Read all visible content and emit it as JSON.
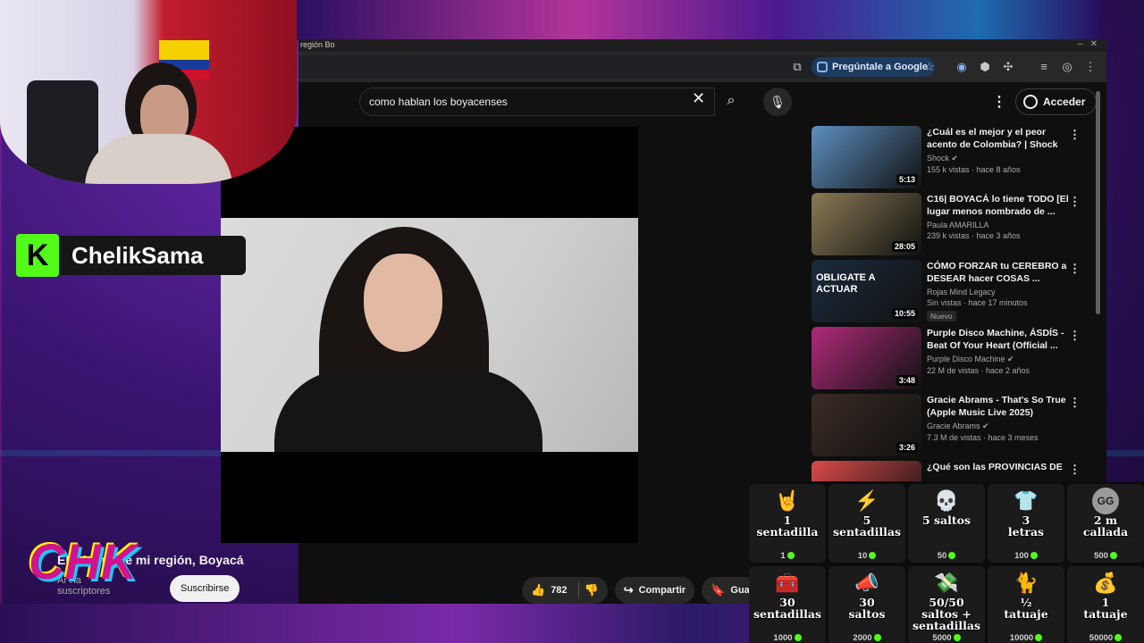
{
  "browser": {
    "tab_title": "región Bo",
    "ask_google_label": "Pregúntale a Google"
  },
  "youtube": {
    "search_query": "como hablan los boyacenses",
    "signin_label": "Acceder",
    "video": {
      "title": "El género de mi región, Boyacá",
      "channel_fragment": "Ar ría",
      "subscribers": "suscriptores",
      "subscribe_label": "Suscribirse",
      "likes": "782",
      "share_label": "Compartir",
      "save_label": "Guard"
    },
    "recommendations": [
      {
        "title": "¿Cuál es el mejor y el peor acento de Colombia? | Shock",
        "channel": "Shock",
        "verified": true,
        "views": "155 k vistas · hace 8 años",
        "duration": "5:13",
        "thumb_color": "#5d8fbf",
        "badge": ""
      },
      {
        "title": "C16| BOYACÁ lo tiene TODO [El lugar menos nombrado de ...",
        "channel": "Paula AMARILLA",
        "verified": false,
        "views": "239 k vistas · hace 3 años",
        "duration": "28:05",
        "thumb_color": "#8a7a55",
        "badge": ""
      },
      {
        "title": "CÓMO FORZAR tu CEREBRO a DESEAR hacer COSAS ...",
        "channel": "Rojas Mind Legacy",
        "verified": false,
        "views": "Sin vistas · hace 17 minutos",
        "duration": "10:55",
        "thumb_color": "#1c2b3d",
        "badge": "Nuevo",
        "thumb_text": "OBLIGATE A ACTUAR"
      },
      {
        "title": "Purple Disco Machine, ÁSDÍS - Beat Of Your Heart (Official ...",
        "channel": "Purple Disco Machine",
        "verified": true,
        "views": "22 M de vistas · hace 2 años",
        "duration": "3:48",
        "thumb_color": "#b02a7a",
        "badge": ""
      },
      {
        "title": "Gracie Abrams - That's So True (Apple Music Live 2025)",
        "channel": "Gracie Abrams",
        "verified": true,
        "views": "7.3 M de vistas · hace 3 meses",
        "duration": "3:26",
        "thumb_color": "#3a2c24",
        "badge": ""
      },
      {
        "title": "¿Qué son las PROVINCIAS DE",
        "channel": "",
        "verified": false,
        "views": "",
        "duration": "",
        "thumb_color": "#d94a4a",
        "badge": ""
      }
    ]
  },
  "stream": {
    "streamer_name": "ChelikSama",
    "logo_letter": "K",
    "overlay_logo": "CHK",
    "kick_green": "#53fc18"
  },
  "rewards": [
    {
      "label": "1\nsentadilla",
      "cost": "1",
      "icon": "rock-hand-icon",
      "glyph": "🤘",
      "color": "#f0c070"
    },
    {
      "label": "5\nsentadillas",
      "cost": "10",
      "icon": "lightning-icon",
      "glyph": "⚡",
      "color": "#f2b62a"
    },
    {
      "label": "5 saltos",
      "cost": "50",
      "icon": "skull-icon",
      "glyph": "💀",
      "color": "#c8e6c0"
    },
    {
      "label": "3\nletras",
      "cost": "100",
      "icon": "shirt-icon",
      "glyph": "👕",
      "color": "#e0e0e0"
    },
    {
      "label": "2 m\ncallada",
      "cost": "500",
      "icon": "gg-coin-icon",
      "glyph": "GG",
      "color": "#9a9a9a"
    },
    {
      "label": "30\nsentadillas",
      "cost": "1000",
      "icon": "treasure-chest-icon",
      "glyph": "🧰",
      "color": "#29b3a3"
    },
    {
      "label": "30\nsaltos",
      "cost": "2000",
      "icon": "megaphone-icon",
      "glyph": "📣",
      "color": "#d0d0d0"
    },
    {
      "label": "50/50\nsaltos +\nsentadillas",
      "cost": "5000",
      "icon": "coins-icon",
      "glyph": "💸",
      "color": "#53fc18"
    },
    {
      "label": "½\ntatuaje",
      "cost": "10000",
      "icon": "cat-icon",
      "glyph": "🐈",
      "color": "#e8d9b0"
    },
    {
      "label": "1\ntatuaje",
      "cost": "50000",
      "icon": "money-bag-icon",
      "glyph": "💰",
      "color": "#3fbf5a"
    }
  ]
}
